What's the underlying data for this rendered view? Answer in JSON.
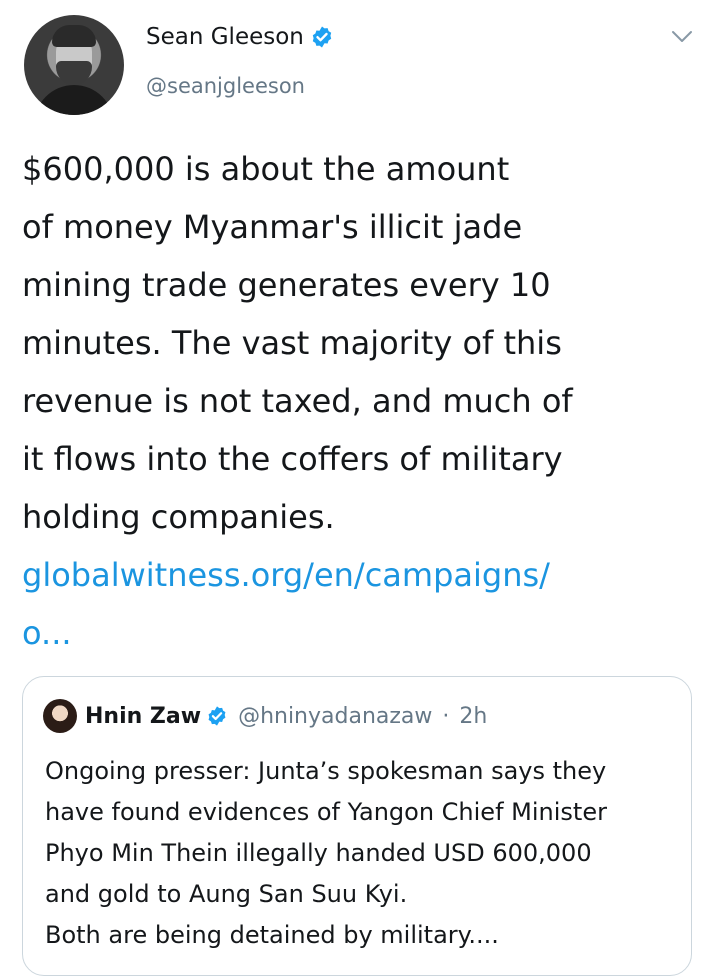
{
  "author": {
    "name": "Sean Gleeson",
    "handle": "@seanjgleeson",
    "verified": true
  },
  "tweet": {
    "lines": [
      "$600,000 is about the amount",
      "of money Myanmar's illicit jade",
      "mining trade generates every 10",
      "minutes. The vast majority of this",
      "revenue is not taxed, and much of",
      "it flows into the coffers of military",
      "holding companies."
    ],
    "link_lines": [
      "globalwitness.org/en/campaigns/",
      "o..."
    ]
  },
  "quoted": {
    "name": "Hnin Zaw",
    "handle": "@hninyadanazaw",
    "separator": "·",
    "time": "2h",
    "verified": true,
    "lines": [
      "Ongoing presser: Junta’s spokesman says they",
      "have found evidences of Yangon Chief Minister",
      "Phyo Min Thein illegally handed USD 600,000",
      "and gold to Aung San Suu Kyi.",
      "Both are being detained by military...."
    ]
  },
  "colors": {
    "text": "#14171a",
    "secondary": "#657786",
    "link": "#1b95e0",
    "verified": "#1da1f2",
    "border": "#ccd6dd"
  },
  "icons": {
    "verified": "verified-badge-icon",
    "menu": "chevron-down-icon"
  }
}
